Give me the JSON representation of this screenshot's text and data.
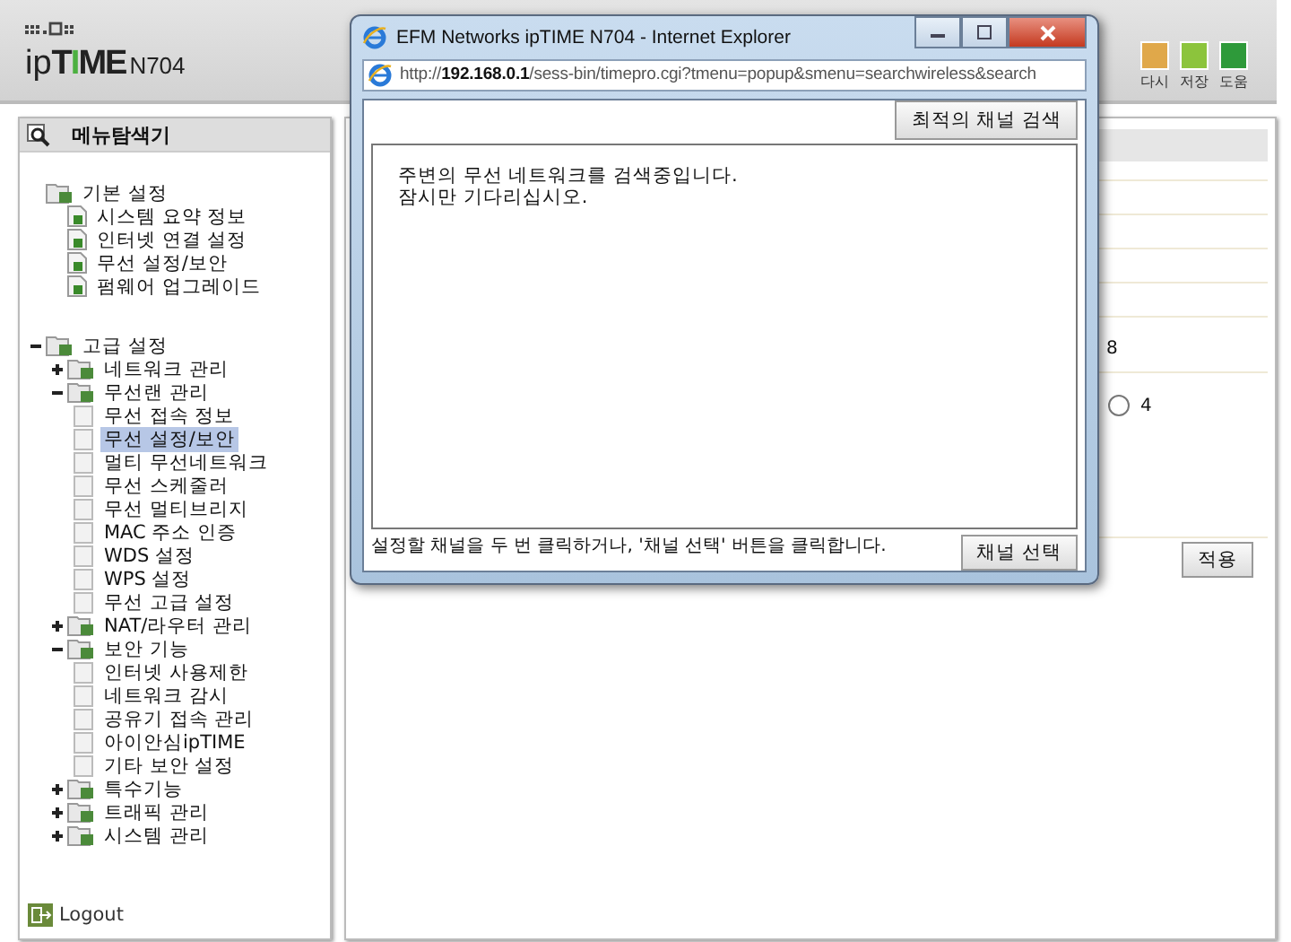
{
  "header": {
    "logo": {
      "prefix": "ip",
      "brand": "TIME",
      "model": "N704"
    },
    "toolbar": [
      {
        "label": "다시",
        "color": "#e0a84a"
      },
      {
        "label": "저장",
        "color": "#8cc43c"
      },
      {
        "label": "도움",
        "color": "#2e9a3a"
      }
    ]
  },
  "sidebar": {
    "title": "메뉴탐색기",
    "tree": [
      {
        "kind": "root",
        "label": "기본 설정",
        "children": [
          {
            "kind": "page",
            "label": "시스템 요약 정보",
            "selected": false
          },
          {
            "kind": "page",
            "label": "인터넷 연결 설정",
            "selected": false
          },
          {
            "kind": "page",
            "label": "무선 설정/보안",
            "selected": false
          },
          {
            "kind": "page",
            "label": "펌웨어 업그레이드",
            "selected": false
          }
        ]
      },
      {
        "kind": "folder",
        "label": "고급 설정",
        "expanded": true,
        "children": [
          {
            "kind": "folder",
            "label": "네트워크 관리",
            "expanded": false
          },
          {
            "kind": "folder",
            "label": "무선랜 관리",
            "expanded": true,
            "children": [
              {
                "kind": "item",
                "label": "무선 접속 정보",
                "selected": false
              },
              {
                "kind": "item",
                "label": "무선 설정/보안",
                "selected": true
              },
              {
                "kind": "item",
                "label": "멀티 무선네트워크",
                "selected": false
              },
              {
                "kind": "item",
                "label": "무선 스케줄러",
                "selected": false
              },
              {
                "kind": "item",
                "label": "무선 멀티브리지",
                "selected": false
              },
              {
                "kind": "item",
                "label": "MAC 주소 인증",
                "selected": false
              },
              {
                "kind": "item",
                "label": "WDS 설정",
                "selected": false
              },
              {
                "kind": "item",
                "label": "WPS 설정",
                "selected": false
              },
              {
                "kind": "item",
                "label": "무선 고급 설정",
                "selected": false
              }
            ]
          },
          {
            "kind": "folder",
            "label": "NAT/라우터 관리",
            "expanded": false
          },
          {
            "kind": "folder",
            "label": "보안 기능",
            "expanded": true,
            "children": [
              {
                "kind": "item",
                "label": "인터넷 사용제한",
                "selected": false
              },
              {
                "kind": "item",
                "label": "네트워크 감시",
                "selected": false
              },
              {
                "kind": "item",
                "label": "공유기 접속 관리",
                "selected": false
              },
              {
                "kind": "item",
                "label": "아이안심ipTIME",
                "selected": false
              },
              {
                "kind": "item",
                "label": "기타 보안 설정",
                "selected": false
              }
            ]
          },
          {
            "kind": "folder",
            "label": "특수기능",
            "expanded": false
          },
          {
            "kind": "folder",
            "label": "트래픽 관리",
            "expanded": false
          },
          {
            "kind": "folder",
            "label": "시스템 관리",
            "expanded": false
          }
        ]
      }
    ],
    "logout": "Logout"
  },
  "main": {
    "fragment": "8",
    "radio": {
      "label": "4",
      "selected": false
    },
    "apply_button": "적용"
  },
  "popup": {
    "title": "EFM Networks ipTIME N704 - Internet Explorer",
    "url": "http://**192.168.0.1**/sess-bin/timepro.cgi?tmenu=popup&smenu=searchwireless&search",
    "search_button": "최적의 채널 검색",
    "message": [
      "주변의 무선 네트워크를 검색중입니다.",
      "잠시만 기다리십시오."
    ],
    "hint": "설정할 채널을 두 번 클릭하거나, '채널 선택' 버튼을 클릭합니다.",
    "select_button": "채널 선택"
  }
}
